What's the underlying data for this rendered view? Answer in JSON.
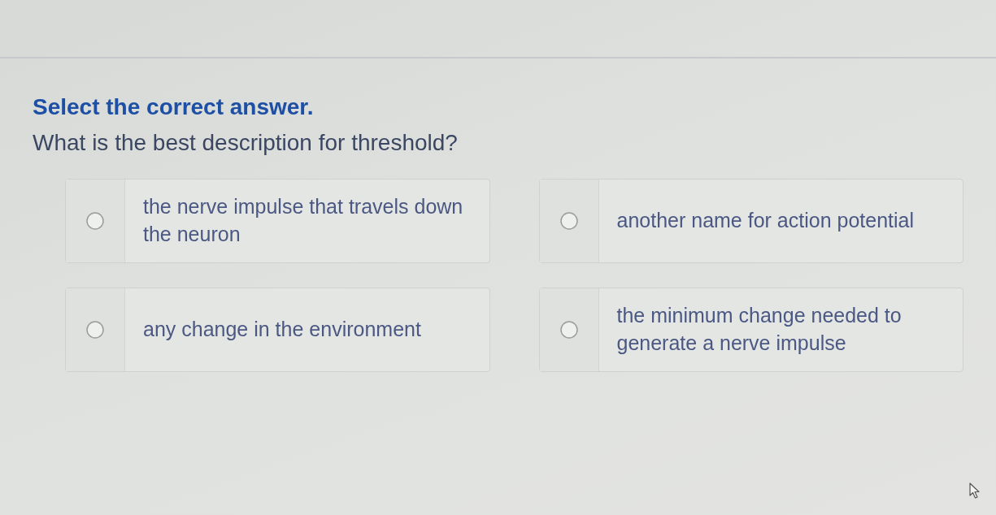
{
  "heading": "Select the correct answer.",
  "question": "What is the best description for threshold?",
  "options": [
    {
      "text": "the nerve impulse that travels down the neuron",
      "selected": false
    },
    {
      "text": "another name for action potential",
      "selected": false
    },
    {
      "text": "any change in the environment",
      "selected": false
    },
    {
      "text": "the minimum change needed to generate a nerve impulse",
      "selected": false
    }
  ]
}
